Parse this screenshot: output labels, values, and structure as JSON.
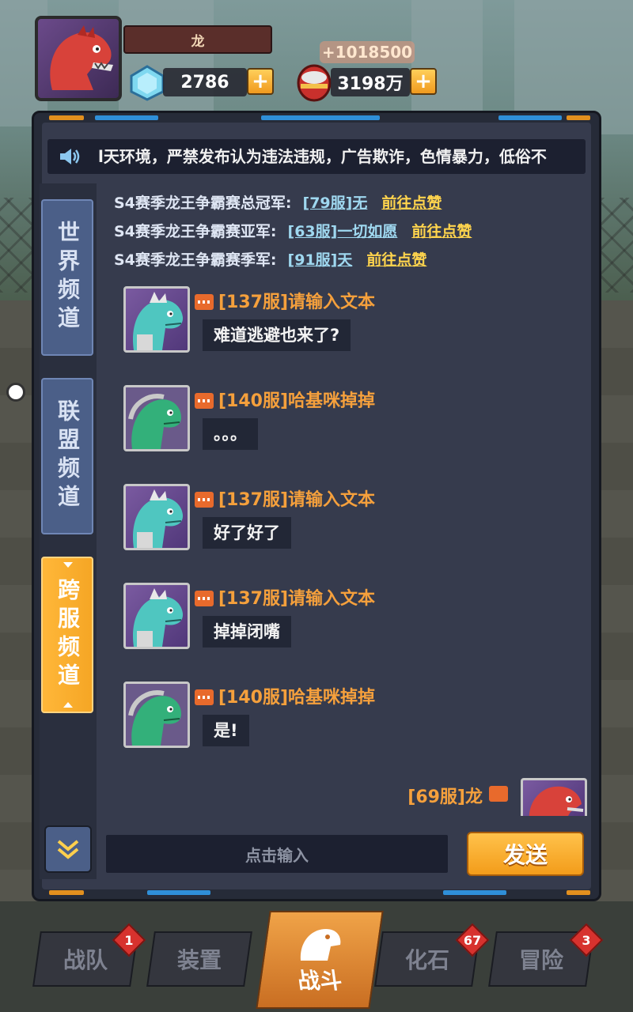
{
  "player": {
    "name": "龙",
    "gems": "2786",
    "coins": "3198万",
    "coin_gain": "+1018500"
  },
  "marquee": {
    "text": "l天环境，严禁发布认为违法违规，广告欺诈，色情暴力，低俗不"
  },
  "tabs": [
    {
      "label": "世界频道",
      "active": false
    },
    {
      "label": "联盟频道",
      "active": false
    },
    {
      "label": "跨服频道",
      "active": true
    }
  ],
  "announcements": [
    {
      "title": "S4赛季龙王争霸赛总冠军:",
      "server_name": "[79服]无",
      "action": "前往点赞"
    },
    {
      "title": "S4赛季龙王争霸赛亚军:",
      "server_name": "[63服]一切如愿",
      "action": "前往点赞"
    },
    {
      "title": "S4赛季龙王争霸赛季军:",
      "server_name": "[91服]天",
      "action": "前往点赞"
    }
  ],
  "messages": [
    {
      "sender": "[137服]请输入文本",
      "text": "难道逃避也来了?",
      "avatar": "teal-dino"
    },
    {
      "sender": "[140服]哈基咪掉掉",
      "text": "。。。",
      "avatar": "green-dino"
    },
    {
      "sender": "[137服]请输入文本",
      "text": "好了好了",
      "avatar": "teal-dino"
    },
    {
      "sender": "[137服]请输入文本",
      "text": "掉掉闭嘴",
      "avatar": "teal-dino"
    },
    {
      "sender": "[140服]哈基咪掉掉",
      "text": "是!",
      "avatar": "green-dino"
    }
  ],
  "self_message": {
    "sender": "[69服]龙"
  },
  "input": {
    "placeholder": "点击输入",
    "send_label": "发送"
  },
  "nav": [
    {
      "label": "战队",
      "badge": "1"
    },
    {
      "label": "装置",
      "badge": ""
    },
    {
      "label": "战斗",
      "badge": ""
    },
    {
      "label": "化石",
      "badge": "67"
    },
    {
      "label": "冒险",
      "badge": "3"
    }
  ],
  "colors": {
    "accent_orange": "#f5a03c",
    "panel": "#363b4d",
    "link_blue": "#9fd8f0",
    "link_yellow": "#ffd44d"
  }
}
